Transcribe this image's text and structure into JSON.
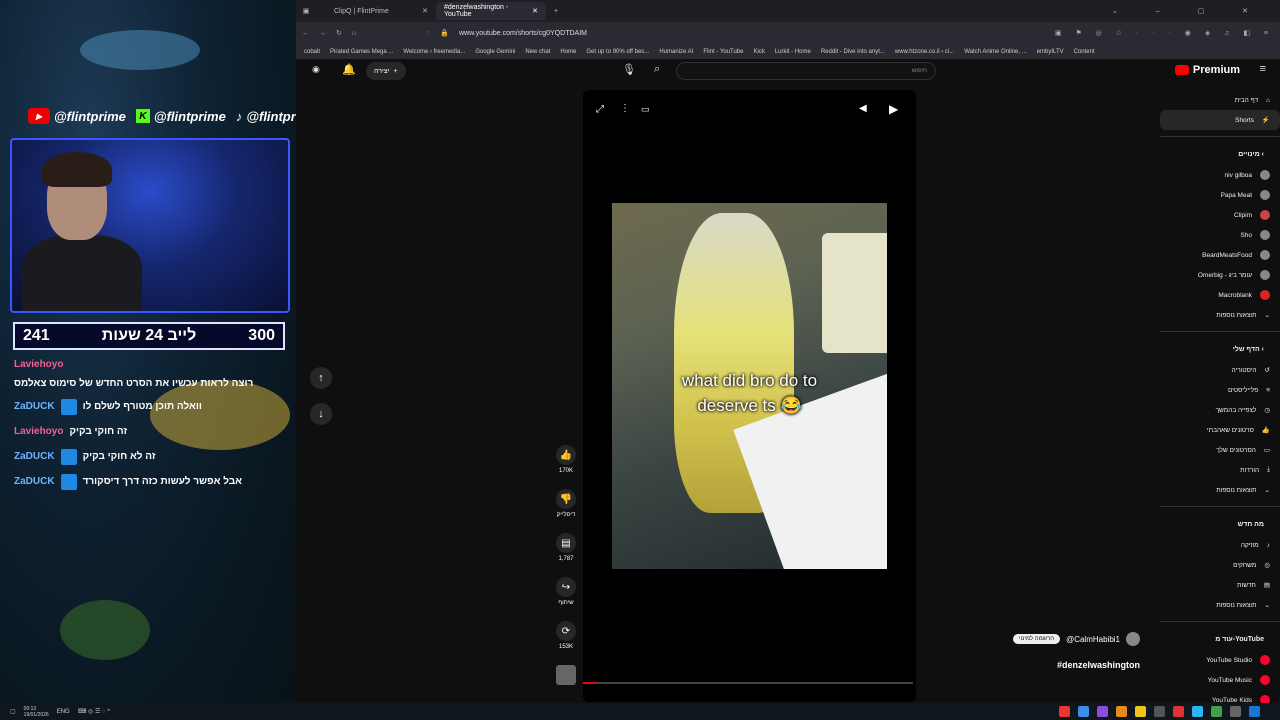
{
  "stream": {
    "socials": [
      {
        "platform": "youtube",
        "handle": "@flintprime"
      },
      {
        "platform": "kick",
        "handle": "@flintprime"
      },
      {
        "platform": "tiktok",
        "handle": "@flintprime"
      }
    ],
    "counter": {
      "left": "241",
      "title": "לייב 24 שעות",
      "right": "300"
    },
    "chat": [
      {
        "user": "Laviehoyo",
        "msg": ""
      },
      {
        "user": "",
        "msg": "רוצה לראות עכשיו את הסרט החדש של סימוס צאלמס"
      },
      {
        "user": "ZaDUCK",
        "msg": "וואלה תוכן מטורף לשלם לו"
      },
      {
        "user": "Laviehoyo",
        "msg": "זה חוקי בקיק"
      },
      {
        "user": "ZaDUCK",
        "msg": "זה לא חוקי בקיק"
      },
      {
        "user": "ZaDUCK",
        "msg": "אבל אפשר לעשות כזה דרך דיסקורד"
      }
    ]
  },
  "browser": {
    "tabs": [
      {
        "label": "ClipQ | FlintPrime",
        "active": false
      },
      {
        "label": "#denzelwashington - YouTube",
        "active": true
      }
    ],
    "url": "www.youtube.com/shorts/cg0YQDTDAIM",
    "bookmarks": [
      "cobalt",
      "Pirated Games Mega ...",
      "Welcome › freemedia...",
      "Google Gemini",
      "New chat",
      "Home",
      "Get up to 90% off bes...",
      "Humanize AI",
      "Flint - YouTube",
      "Kick",
      "Lurkit - Home",
      "Reddit - Dive into anyt...",
      "www.htzone.co.il › ci...",
      "Watch Anime Online, ...",
      "embyILTV",
      "Content"
    ]
  },
  "youtube": {
    "premium_label": "Premium",
    "create_label": "יצירה",
    "search_placeholder": "חיפוש",
    "sidebar": {
      "main": [
        {
          "label": "דף הבית",
          "icon": "home-icon"
        },
        {
          "label": "Shorts",
          "icon": "shorts-icon",
          "active": true
        }
      ],
      "subscriptions_title": "מינויים",
      "subscriptions": [
        "niv gilboa",
        "Papa Meat",
        "Clipim",
        "Sho",
        "BeardMeatsFood",
        "Omerbig - עומר ביג",
        "Macroblank"
      ],
      "show_more": "תוצאות נוספות",
      "you_title": "הדף שלי",
      "you_items": [
        "היסטוריה",
        "פלייליסטים",
        "לצפייה בהמשך",
        "סרטונים שאהבתי",
        "הסרטונים שלך",
        "הורדות"
      ],
      "you_more": "תוצאות נוספות",
      "explore_title": "מה חדש",
      "explore": [
        "מוזיקה",
        "משחקים",
        "חדשות"
      ],
      "explore_more": "תוצאות נוספות",
      "more_from_title": "עוד מ-YouTube",
      "more_from": [
        "YouTube Studio",
        "YouTube Music",
        "YouTube Kids"
      ]
    },
    "short": {
      "caption_line1": "what did bro do to",
      "caption_line2": "deserve ts 😂",
      "progress_fraction": 0.04,
      "likes": "170K",
      "dislike_label": "דיסלייק",
      "comments": "1,787",
      "share_label": "שיתוף",
      "remix": "153K",
      "channel": "@CalmHabibi1",
      "subscribe_label": "הרשמה למינוי",
      "hashtag": "#denzelwashington"
    }
  },
  "taskbar": {
    "time": "00:13",
    "date": "19/01/2026",
    "lang": "ENG"
  },
  "colors": {
    "accent_red": "#ff0000",
    "counter_border": "#dfe3ff",
    "webcam_border": "#3b55ff"
  }
}
